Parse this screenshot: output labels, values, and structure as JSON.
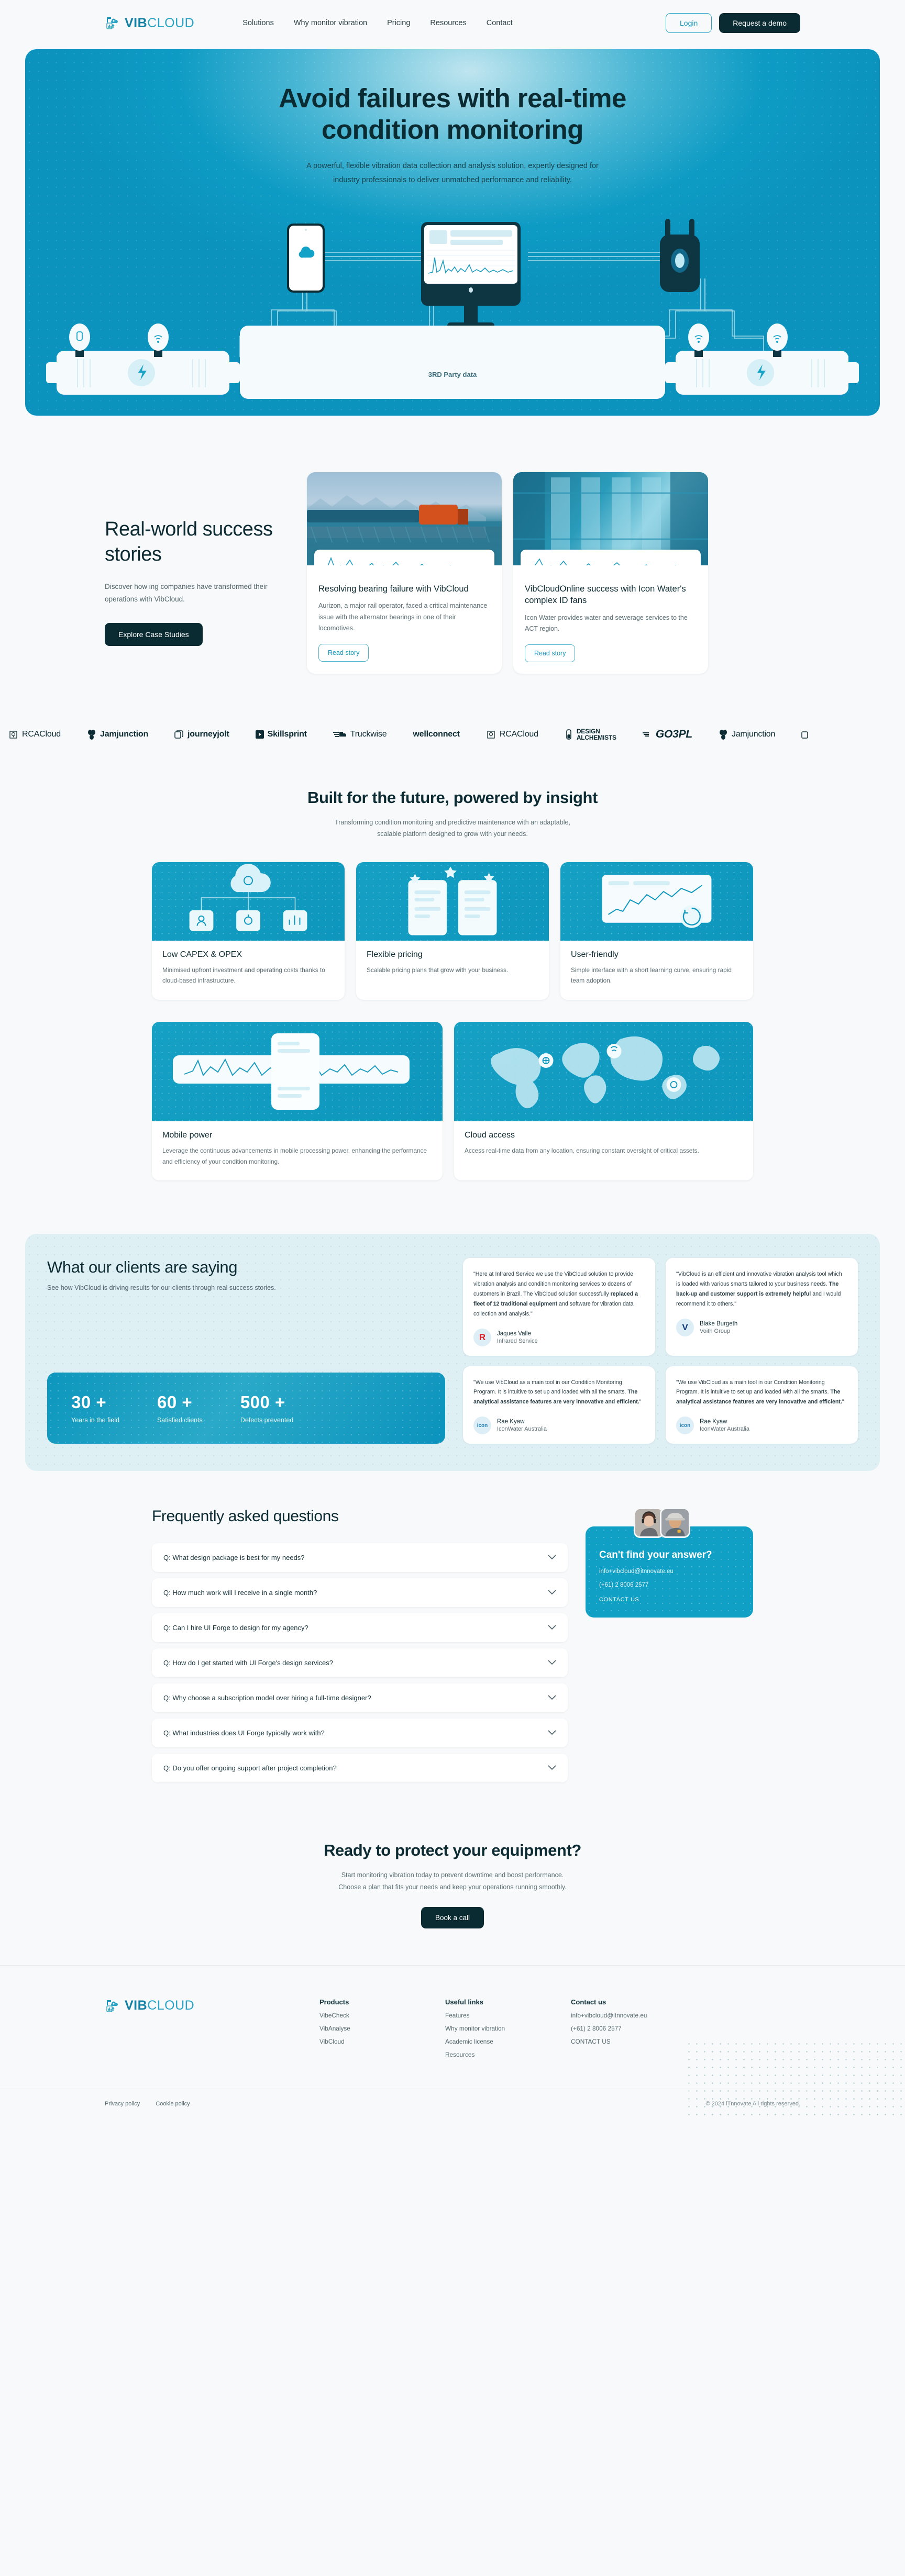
{
  "brand": {
    "bold": "VIB",
    "light": "CLOUD"
  },
  "nav": {
    "links": [
      "Solutions",
      "Why monitor vibration",
      "Pricing",
      "Resources",
      "Contact"
    ],
    "login_label": "Login",
    "demo_label": "Request a demo"
  },
  "hero": {
    "title_line1": "Avoid failures with real-time",
    "title_line2": "condition monitoring",
    "subtitle": "A powerful, flexible vibration data collection and analysis solution, expertly designed for industry professionals to deliver unmatched performance and reliability.",
    "diagram_label": "3RD Party data"
  },
  "stories": {
    "heading": "Real-world success stories",
    "subtitle": "Discover how ing companies have transformed their operations with VibCloud.",
    "cta_label": "Explore Case Studies",
    "cards": [
      {
        "title": "Resolving bearing failure with VibCloud",
        "body": "Aurizon, a major rail operator, faced a critical maintenance issue with the alternator bearings in one of their locomotives.",
        "link_label": "Read story"
      },
      {
        "title": "VibCloudOnline success with Icon Water's complex ID fans",
        "body": "Icon Water provides water and sewerage services to the ACT region.",
        "link_label": "Read story"
      }
    ]
  },
  "logos": [
    {
      "name": "RCACloud",
      "icon": "tree-badge-icon",
      "weight": "thin"
    },
    {
      "name": "Jamjunction",
      "icon": "butterfly-icon",
      "weight": "bold"
    },
    {
      "name": "journeyjolt",
      "icon": "copy-pages-icon",
      "weight": "bold"
    },
    {
      "name": "Skillsprint",
      "icon": "play-square-icon",
      "weight": "bold"
    },
    {
      "name": "Truckwise",
      "icon": "truck-speed-icon",
      "weight": "thin"
    },
    {
      "name": "wellconnect",
      "icon": "wordmark-icon",
      "weight": "bold"
    },
    {
      "name": "RCACloud",
      "icon": "tree-badge-icon",
      "weight": "thin"
    },
    {
      "name": "DESIGN ALCHEMISTS",
      "icon": "flask-icon",
      "weight": "bold"
    },
    {
      "name": "GO3PL",
      "icon": "speed-lines-icon",
      "weight": "bold"
    },
    {
      "name": "Jamjunction",
      "icon": "butterfly-icon",
      "weight": "thin"
    },
    {
      "name": "",
      "icon": "copy-pages-icon",
      "weight": "thin"
    }
  ],
  "features": {
    "heading": "Built for the future, powered by insight",
    "subtitle": "Transforming condition monitoring and predictive maintenance with an adaptable, scalable platform designed to grow with your needs.",
    "cards": [
      {
        "title": "Low CAPEX & OPEX",
        "body": "Minimised upfront investment and operating costs thanks to cloud-based infrastructure.",
        "art": "network-nodes-art"
      },
      {
        "title": "Flexible pricing",
        "body": "Scalable pricing plans that grow with your business.",
        "art": "pricing-cards-art"
      },
      {
        "title": "User-friendly",
        "body": "Simple interface with a short learning curve, ensuring rapid team adoption.",
        "art": "dashboard-art"
      }
    ],
    "wide_cards": [
      {
        "title": "Mobile power",
        "body": "Leverage the continuous advancements in mobile processing power, enhancing the performance and efficiency of your condition monitoring.",
        "art": "mobile-waveform-art"
      },
      {
        "title": "Cloud access",
        "body": "Access real-time data from any location, ensuring constant oversight of critical assets.",
        "art": "world-map-art"
      }
    ]
  },
  "testimonials": {
    "heading": "What our clients are saying",
    "subtitle": "See how VibCloud is driving results for our clients through real success stories.",
    "stats": [
      {
        "num": "30 +",
        "label": "Years in the field"
      },
      {
        "num": "60 +",
        "label": "Satisfied clients"
      },
      {
        "num": "500 +",
        "label": "Defects prevented"
      }
    ],
    "cards": [
      {
        "quote_1": "\"Here at Infrared Service we use the VibCloud solution to provide vibration analysis and condition monitoring services to dozens of customers in Brazil. The VibCloud solution successfully ",
        "quote_bold": "replaced a fleet of 12 traditional equipment",
        "quote_2": " and software for vibration data collection and analysis.\"",
        "name": "Jaques Valle",
        "org": "Infrared Service",
        "avatar_letter": "R",
        "avatar_color": "#d72128"
      },
      {
        "quote_1": "\"VibCloud is an efficient and innovative vibration analysis tool which is loaded with various smarts tailored to your business needs. ",
        "quote_bold": "The back-up and customer support is extremely helpful",
        "quote_2": " and I would recommend it to others.\"",
        "name": "Blake Burgeth",
        "org": "Voith Group",
        "avatar_letter": "V",
        "avatar_color": "#11387a"
      },
      {
        "quote_1": "\"We use VibCloud as a main tool in our Condition Monitoring Program. It is intuitive to set up and loaded with all the smarts. ",
        "quote_bold": "The analytical assistance features are very innovative and efficient.",
        "quote_2": "\"",
        "name": "Rae Kyaw",
        "org": "IconWater Australia",
        "avatar_letter": "icon",
        "avatar_color": "#1d7fb8"
      },
      {
        "quote_1": "\"We use VibCloud as a main tool in our Condition Monitoring Program. It is intuitive to set up and loaded with all the smarts. ",
        "quote_bold": "The analytical assistance features are very innovative and efficient.",
        "quote_2": "\"",
        "name": "Rae Kyaw",
        "org": "IconWater Australia",
        "avatar_letter": "icon",
        "avatar_color": "#1d7fb8"
      }
    ]
  },
  "faq": {
    "heading": "Frequently asked questions",
    "items": [
      "Q: What design package is best for my needs?",
      "Q: How much work will I receive in a single month?",
      "Q: Can I hire UI Forge to design for my agency?",
      "Q: How do I get started with UI Forge's design services?",
      "Q: Why choose a subscription model over hiring a full-time designer?",
      "Q: What industries does UI Forge typically work with?",
      "Q: Do you offer ongoing support after project completion?"
    ],
    "cta": {
      "title": "Can't find your answer?",
      "email": "info+vibcloud@itnnovate.eu",
      "phone": "(+61) 2 8006 2577",
      "link_label": "CONTACT US"
    }
  },
  "final_cta": {
    "heading": "Ready to protect your equipment?",
    "body": "Start monitoring vibration today to prevent downtime and boost performance. Choose a plan that fits your needs and keep your operations running smoothly.",
    "button_label": "Book a call"
  },
  "footer": {
    "columns": [
      {
        "title": "Products",
        "links": [
          "VibeCheck",
          "VibAnalyse",
          "VibCloud"
        ]
      },
      {
        "title": "Useful links",
        "links": [
          "Features",
          "Why monitor vibration",
          "Academic license",
          "Resources"
        ]
      },
      {
        "title": "Contact us",
        "links": [
          "info+vibcloud@itnnovate.eu",
          "(+61) 2 8006 2577",
          "CONTACT US"
        ]
      }
    ],
    "legal": [
      "Privacy policy",
      "Cookie policy"
    ],
    "copyright": "© 2024 iTnnovate All rights reserved."
  },
  "colors": {
    "accent": "#10a0c5",
    "dark": "#0b2b33",
    "page_bg": "#f7f9fa",
    "testimonial_bg": "#dff0f5"
  }
}
